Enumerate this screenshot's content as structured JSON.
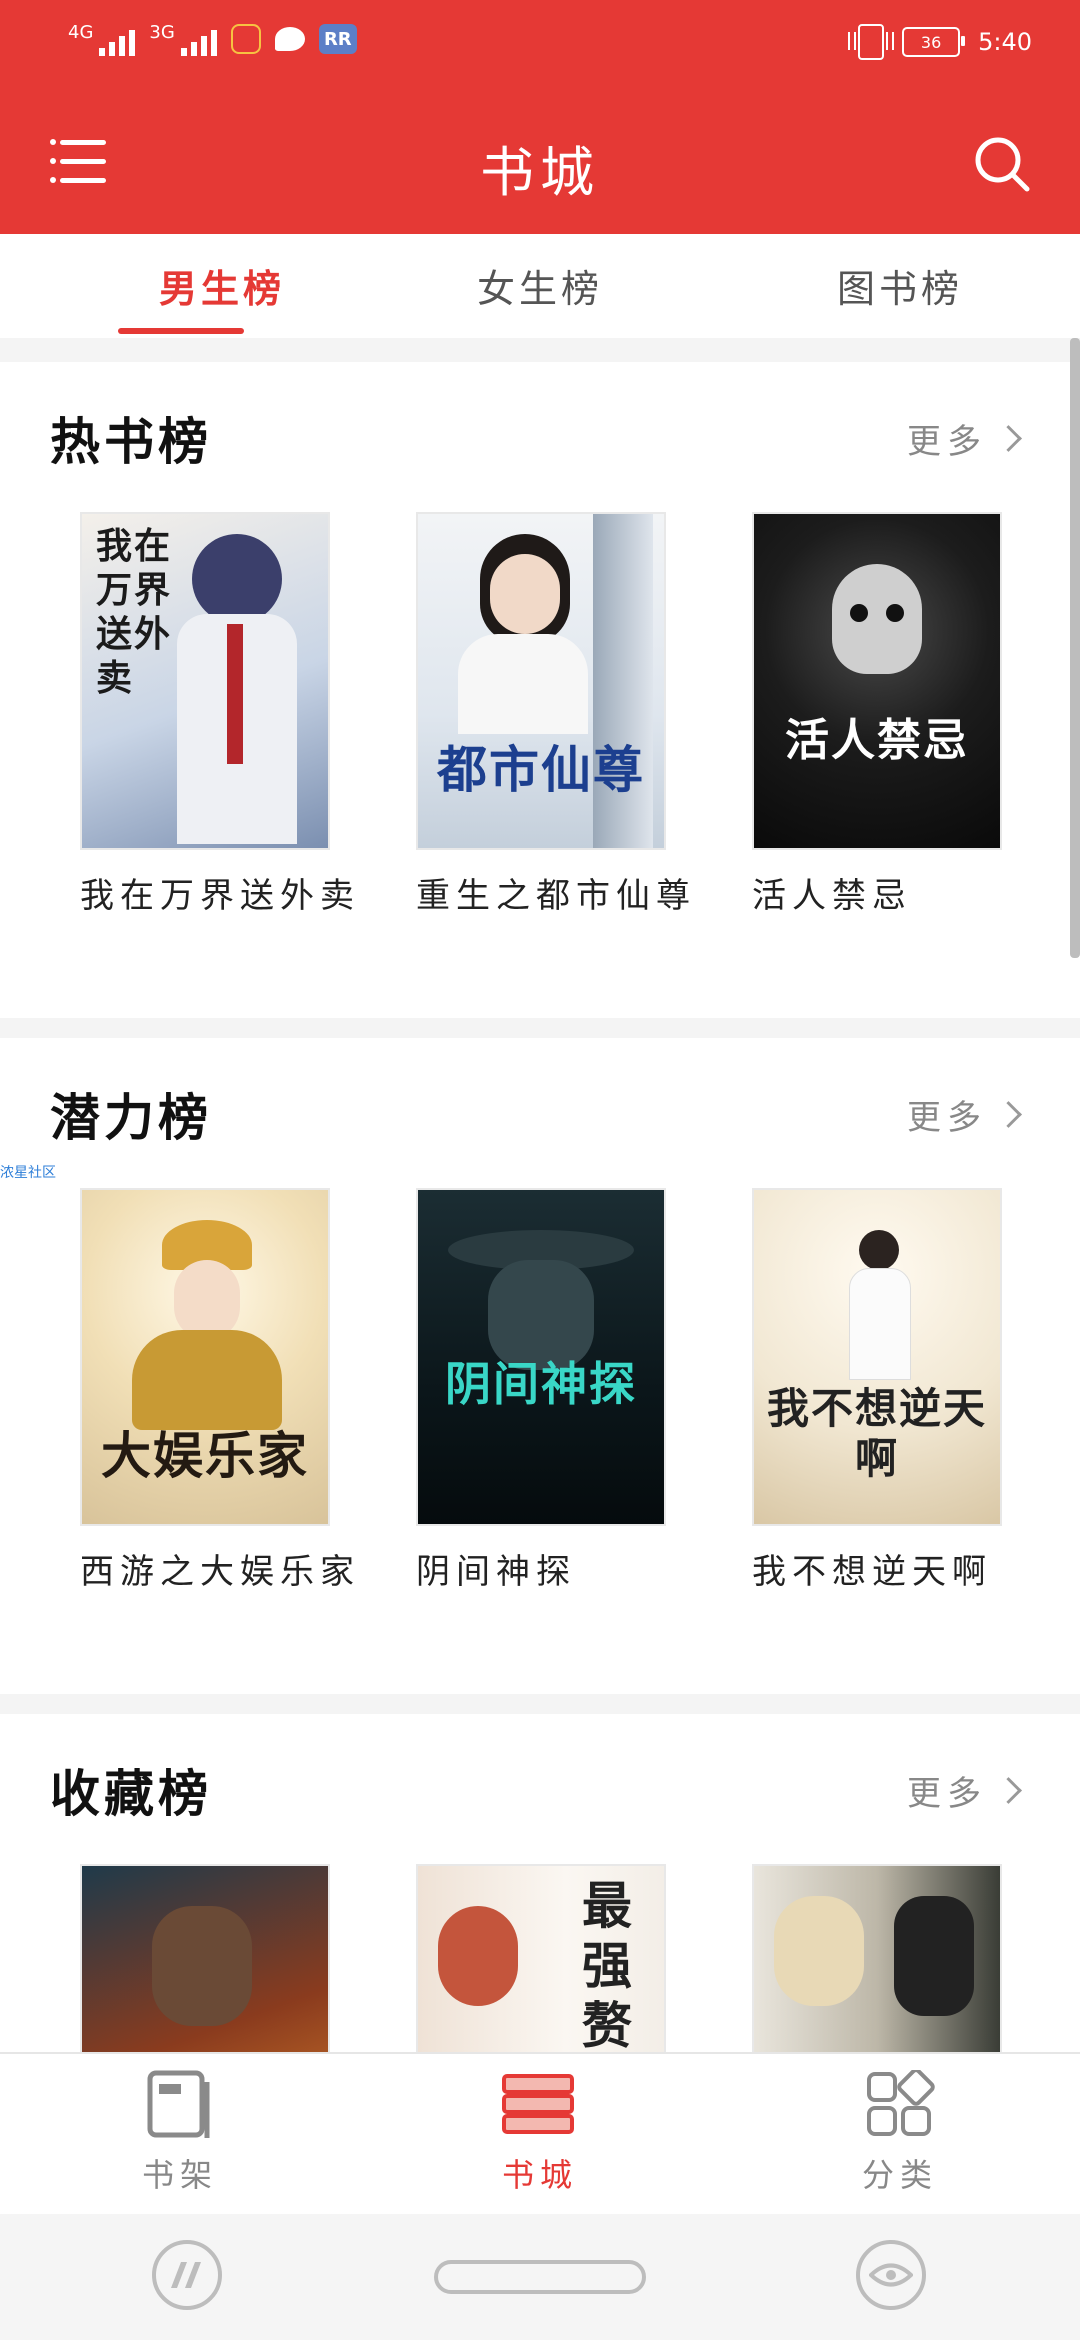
{
  "status_bar": {
    "signal1_label": "4G",
    "signal2_label": "3G",
    "app_badge": "RR",
    "battery": "36",
    "time": "5:40"
  },
  "app_bar": {
    "title": "书城",
    "menu_icon": "menu-icon",
    "search_icon": "search-icon"
  },
  "tabs": [
    {
      "label": "男生榜",
      "active": true
    },
    {
      "label": "女生榜",
      "active": false
    },
    {
      "label": "图书榜",
      "active": false
    }
  ],
  "sections": [
    {
      "title": "热书榜",
      "more": "更多",
      "books": [
        {
          "title": "我在万界送外卖",
          "cover_color": "#dfe6f0"
        },
        {
          "title": "重生之都市仙尊",
          "cover_color": "#e9eef3"
        },
        {
          "title": "活人禁忌",
          "cover_color": "#1a1a1a"
        }
      ]
    },
    {
      "title": "潜力榜",
      "more": "更多",
      "books": [
        {
          "title": "西游之大娱乐家",
          "cover_color": "#f3e8d0"
        },
        {
          "title": "阴间神探",
          "cover_color": "#0d1c22"
        },
        {
          "title": "我不想逆天啊",
          "cover_color": "#f5f1e6"
        }
      ]
    },
    {
      "title": "收藏榜",
      "more": "更多",
      "books": [
        {
          "title": "",
          "cover_color": "#3a2a20"
        },
        {
          "title": "",
          "cover_color": "#f1ebe2"
        },
        {
          "title": "",
          "cover_color": "#9a9a92"
        }
      ]
    }
  ],
  "cover_texts": {
    "b1": "我在万界送外卖",
    "b2": "都市仙尊",
    "b3": "活人禁忌",
    "b4": "大娱乐家",
    "b5": "阴间神探",
    "b6": "我不想逆天啊",
    "b8": "最强赘"
  },
  "watermark": "浓星社区",
  "bottom_nav": [
    {
      "label": "书架",
      "icon": "bookshelf-icon",
      "active": false
    },
    {
      "label": "书城",
      "icon": "bookstore-icon",
      "active": true
    },
    {
      "label": "分类",
      "icon": "category-icon",
      "active": false
    }
  ],
  "colors": {
    "accent": "#e53935",
    "background": "#f4f4f4"
  }
}
